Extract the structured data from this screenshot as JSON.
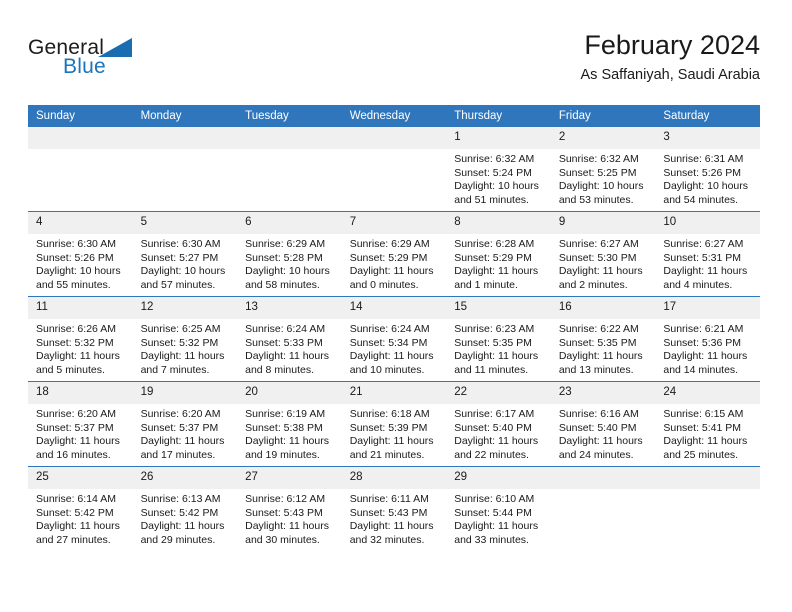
{
  "brand": {
    "name_part1": "General",
    "name_part2": "Blue"
  },
  "header": {
    "month_title": "February 2024",
    "location": "As Saffaniyah, Saudi Arabia"
  },
  "colors": {
    "header_blue": "#2f76bc",
    "brand_blue": "#1b75bb",
    "daynum_band": "#f0f0f0"
  },
  "weekdays": [
    "Sunday",
    "Monday",
    "Tuesday",
    "Wednesday",
    "Thursday",
    "Friday",
    "Saturday"
  ],
  "weeks": [
    [
      {
        "day": "",
        "sunrise": "",
        "sunset": "",
        "daylight1": "",
        "daylight2": ""
      },
      {
        "day": "",
        "sunrise": "",
        "sunset": "",
        "daylight1": "",
        "daylight2": ""
      },
      {
        "day": "",
        "sunrise": "",
        "sunset": "",
        "daylight1": "",
        "daylight2": ""
      },
      {
        "day": "",
        "sunrise": "",
        "sunset": "",
        "daylight1": "",
        "daylight2": ""
      },
      {
        "day": "1",
        "sunrise": "Sunrise: 6:32 AM",
        "sunset": "Sunset: 5:24 PM",
        "daylight1": "Daylight: 10 hours",
        "daylight2": "and 51 minutes."
      },
      {
        "day": "2",
        "sunrise": "Sunrise: 6:32 AM",
        "sunset": "Sunset: 5:25 PM",
        "daylight1": "Daylight: 10 hours",
        "daylight2": "and 53 minutes."
      },
      {
        "day": "3",
        "sunrise": "Sunrise: 6:31 AM",
        "sunset": "Sunset: 5:26 PM",
        "daylight1": "Daylight: 10 hours",
        "daylight2": "and 54 minutes."
      }
    ],
    [
      {
        "day": "4",
        "sunrise": "Sunrise: 6:30 AM",
        "sunset": "Sunset: 5:26 PM",
        "daylight1": "Daylight: 10 hours",
        "daylight2": "and 55 minutes."
      },
      {
        "day": "5",
        "sunrise": "Sunrise: 6:30 AM",
        "sunset": "Sunset: 5:27 PM",
        "daylight1": "Daylight: 10 hours",
        "daylight2": "and 57 minutes."
      },
      {
        "day": "6",
        "sunrise": "Sunrise: 6:29 AM",
        "sunset": "Sunset: 5:28 PM",
        "daylight1": "Daylight: 10 hours",
        "daylight2": "and 58 minutes."
      },
      {
        "day": "7",
        "sunrise": "Sunrise: 6:29 AM",
        "sunset": "Sunset: 5:29 PM",
        "daylight1": "Daylight: 11 hours",
        "daylight2": "and 0 minutes."
      },
      {
        "day": "8",
        "sunrise": "Sunrise: 6:28 AM",
        "sunset": "Sunset: 5:29 PM",
        "daylight1": "Daylight: 11 hours",
        "daylight2": "and 1 minute."
      },
      {
        "day": "9",
        "sunrise": "Sunrise: 6:27 AM",
        "sunset": "Sunset: 5:30 PM",
        "daylight1": "Daylight: 11 hours",
        "daylight2": "and 2 minutes."
      },
      {
        "day": "10",
        "sunrise": "Sunrise: 6:27 AM",
        "sunset": "Sunset: 5:31 PM",
        "daylight1": "Daylight: 11 hours",
        "daylight2": "and 4 minutes."
      }
    ],
    [
      {
        "day": "11",
        "sunrise": "Sunrise: 6:26 AM",
        "sunset": "Sunset: 5:32 PM",
        "daylight1": "Daylight: 11 hours",
        "daylight2": "and 5 minutes."
      },
      {
        "day": "12",
        "sunrise": "Sunrise: 6:25 AM",
        "sunset": "Sunset: 5:32 PM",
        "daylight1": "Daylight: 11 hours",
        "daylight2": "and 7 minutes."
      },
      {
        "day": "13",
        "sunrise": "Sunrise: 6:24 AM",
        "sunset": "Sunset: 5:33 PM",
        "daylight1": "Daylight: 11 hours",
        "daylight2": "and 8 minutes."
      },
      {
        "day": "14",
        "sunrise": "Sunrise: 6:24 AM",
        "sunset": "Sunset: 5:34 PM",
        "daylight1": "Daylight: 11 hours",
        "daylight2": "and 10 minutes."
      },
      {
        "day": "15",
        "sunrise": "Sunrise: 6:23 AM",
        "sunset": "Sunset: 5:35 PM",
        "daylight1": "Daylight: 11 hours",
        "daylight2": "and 11 minutes."
      },
      {
        "day": "16",
        "sunrise": "Sunrise: 6:22 AM",
        "sunset": "Sunset: 5:35 PM",
        "daylight1": "Daylight: 11 hours",
        "daylight2": "and 13 minutes."
      },
      {
        "day": "17",
        "sunrise": "Sunrise: 6:21 AM",
        "sunset": "Sunset: 5:36 PM",
        "daylight1": "Daylight: 11 hours",
        "daylight2": "and 14 minutes."
      }
    ],
    [
      {
        "day": "18",
        "sunrise": "Sunrise: 6:20 AM",
        "sunset": "Sunset: 5:37 PM",
        "daylight1": "Daylight: 11 hours",
        "daylight2": "and 16 minutes."
      },
      {
        "day": "19",
        "sunrise": "Sunrise: 6:20 AM",
        "sunset": "Sunset: 5:37 PM",
        "daylight1": "Daylight: 11 hours",
        "daylight2": "and 17 minutes."
      },
      {
        "day": "20",
        "sunrise": "Sunrise: 6:19 AM",
        "sunset": "Sunset: 5:38 PM",
        "daylight1": "Daylight: 11 hours",
        "daylight2": "and 19 minutes."
      },
      {
        "day": "21",
        "sunrise": "Sunrise: 6:18 AM",
        "sunset": "Sunset: 5:39 PM",
        "daylight1": "Daylight: 11 hours",
        "daylight2": "and 21 minutes."
      },
      {
        "day": "22",
        "sunrise": "Sunrise: 6:17 AM",
        "sunset": "Sunset: 5:40 PM",
        "daylight1": "Daylight: 11 hours",
        "daylight2": "and 22 minutes."
      },
      {
        "day": "23",
        "sunrise": "Sunrise: 6:16 AM",
        "sunset": "Sunset: 5:40 PM",
        "daylight1": "Daylight: 11 hours",
        "daylight2": "and 24 minutes."
      },
      {
        "day": "24",
        "sunrise": "Sunrise: 6:15 AM",
        "sunset": "Sunset: 5:41 PM",
        "daylight1": "Daylight: 11 hours",
        "daylight2": "and 25 minutes."
      }
    ],
    [
      {
        "day": "25",
        "sunrise": "Sunrise: 6:14 AM",
        "sunset": "Sunset: 5:42 PM",
        "daylight1": "Daylight: 11 hours",
        "daylight2": "and 27 minutes."
      },
      {
        "day": "26",
        "sunrise": "Sunrise: 6:13 AM",
        "sunset": "Sunset: 5:42 PM",
        "daylight1": "Daylight: 11 hours",
        "daylight2": "and 29 minutes."
      },
      {
        "day": "27",
        "sunrise": "Sunrise: 6:12 AM",
        "sunset": "Sunset: 5:43 PM",
        "daylight1": "Daylight: 11 hours",
        "daylight2": "and 30 minutes."
      },
      {
        "day": "28",
        "sunrise": "Sunrise: 6:11 AM",
        "sunset": "Sunset: 5:43 PM",
        "daylight1": "Daylight: 11 hours",
        "daylight2": "and 32 minutes."
      },
      {
        "day": "29",
        "sunrise": "Sunrise: 6:10 AM",
        "sunset": "Sunset: 5:44 PM",
        "daylight1": "Daylight: 11 hours",
        "daylight2": "and 33 minutes."
      },
      {
        "day": "",
        "sunrise": "",
        "sunset": "",
        "daylight1": "",
        "daylight2": ""
      },
      {
        "day": "",
        "sunrise": "",
        "sunset": "",
        "daylight1": "",
        "daylight2": ""
      }
    ]
  ]
}
